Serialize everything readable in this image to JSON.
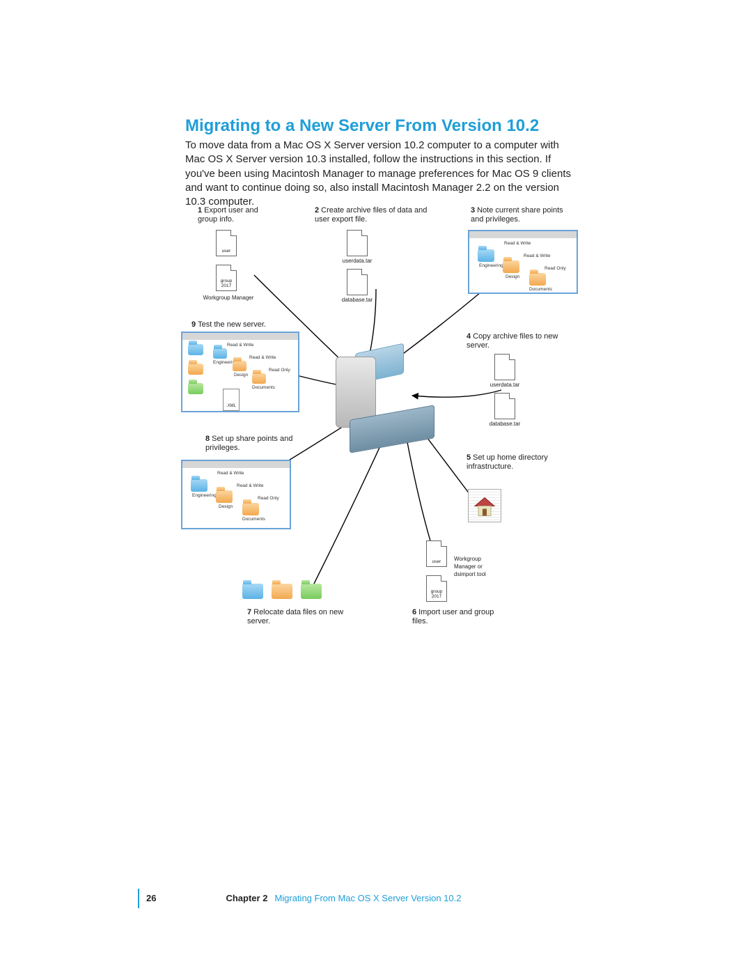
{
  "title": "Migrating to a New Server From Version 10.2",
  "intro": "To move data from a Mac OS X Server version 10.2 computer to a computer with Mac OS X Server version 10.3 installed, follow the instructions in this section. If you've been using Macintosh Manager to manage preferences for Mac OS 9 clients and want to continue doing so, also install Macintosh Manager 2.2 on the version 10.3 computer.",
  "footer": {
    "page": "26",
    "chapter_label": "Chapter 2",
    "chapter_title": "Migrating From Mac OS X Server Version 10.2"
  },
  "steps": {
    "s1": {
      "num": "1",
      "text": "Export user and group info."
    },
    "s2": {
      "num": "2",
      "text": "Create archive files of data and user export file."
    },
    "s3": {
      "num": "3",
      "text": "Note current share points and privileges."
    },
    "s4": {
      "num": "4",
      "text": "Copy archive files to new server."
    },
    "s5": {
      "num": "5",
      "text": "Set up home directory infrastructure."
    },
    "s6": {
      "num": "6",
      "text": "Import user and group files."
    },
    "s7": {
      "num": "7",
      "text": "Relocate data files on new server."
    },
    "s8": {
      "num": "8",
      "text": "Set up share points and privileges."
    },
    "s9": {
      "num": "9",
      "text": "Test the new server."
    }
  },
  "file_labels": {
    "user": "user",
    "group": "group\n2017",
    "userdata": "userdata.tar",
    "database": "database.tar"
  },
  "captions": {
    "wgm": "Workgroup Manager",
    "wgm_or_ds": "Workgroup Manager or dsimport tool",
    "xml": ".XML"
  },
  "privileges": {
    "rw": "Read & Write",
    "ro": "Read Only",
    "eng": "Engineering",
    "design": "Design",
    "docs": "Documents"
  }
}
